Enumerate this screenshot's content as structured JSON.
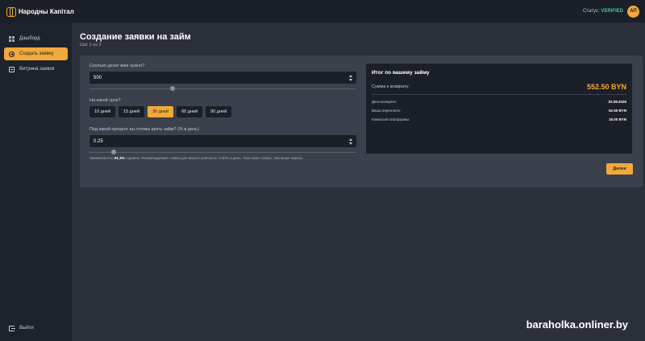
{
  "app": {
    "name": "Народны Капітал",
    "status_label": "Статус:",
    "status_value": "VERIFIED",
    "avatar_initials": "АП"
  },
  "colors": {
    "accent": "#f2a93b",
    "verified": "#3ecf8e",
    "sidebar_bg": "#1e222b",
    "card_bg": "#3a404c"
  },
  "sidebar": {
    "items": [
      {
        "label": "Дашборд",
        "icon": "grid-icon",
        "active": false
      },
      {
        "label": "Создать заявку",
        "icon": "plus-circle-icon",
        "active": true
      },
      {
        "label": "Витрина заявок",
        "icon": "storefront-icon",
        "active": false
      }
    ],
    "logout_label": "Выйти"
  },
  "page": {
    "title": "Создание заявки на займ",
    "step": "Шаг 1 из 3"
  },
  "form": {
    "amount": {
      "label": "Сколько денег вам нужно?",
      "value": "500",
      "slider_level": 0.31
    },
    "term": {
      "label": "На какой срок?",
      "options": [
        "10 дней",
        "15 дней",
        "30 дней",
        "60 дней",
        "90 дней"
      ],
      "selected_index": 2
    },
    "rate": {
      "label": "Под какой процент вы готовы взять займ? (% в день)",
      "value": "0.25",
      "slider_level": 0.09,
      "hint_prefix": "Эквивалентно ",
      "hint_bold": "91.3%",
      "hint_suffix": " годовых. Рекомендуемая ставка для вашего рейтинга: 0.40% в день. Чем ниже ставка, тем выше шансы."
    }
  },
  "summary": {
    "title": "Итог по вашему займу",
    "total_label": "Сумма к возврату:",
    "total_value": "552.50 BYN",
    "rows": [
      {
        "label": "Дата возврата:",
        "value": "02.08.2025"
      },
      {
        "label": "Ваша переплата:",
        "value": "52.50 BYN"
      },
      {
        "label": "Комиссия платформы:",
        "value": "15.00 BYN"
      }
    ]
  },
  "actions": {
    "next_label": "Далее"
  },
  "watermark": "baraholka.onliner.by"
}
